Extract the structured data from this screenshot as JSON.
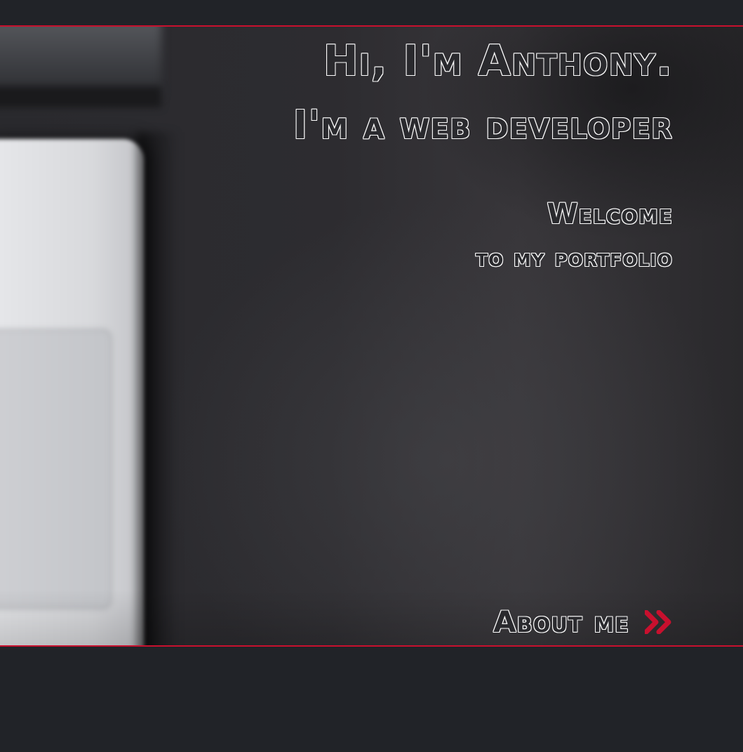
{
  "hero": {
    "greeting": "Hi, I'm Anthony.",
    "role": "I'm a web developer",
    "welcome": "Welcome",
    "subtitle": "to my portfolio",
    "about_label": "About me",
    "about_icon": "double-chevron-right-icon"
  },
  "colors": {
    "accent": "#c8102e",
    "background": "#212328",
    "text_outline": "#ffffff"
  }
}
